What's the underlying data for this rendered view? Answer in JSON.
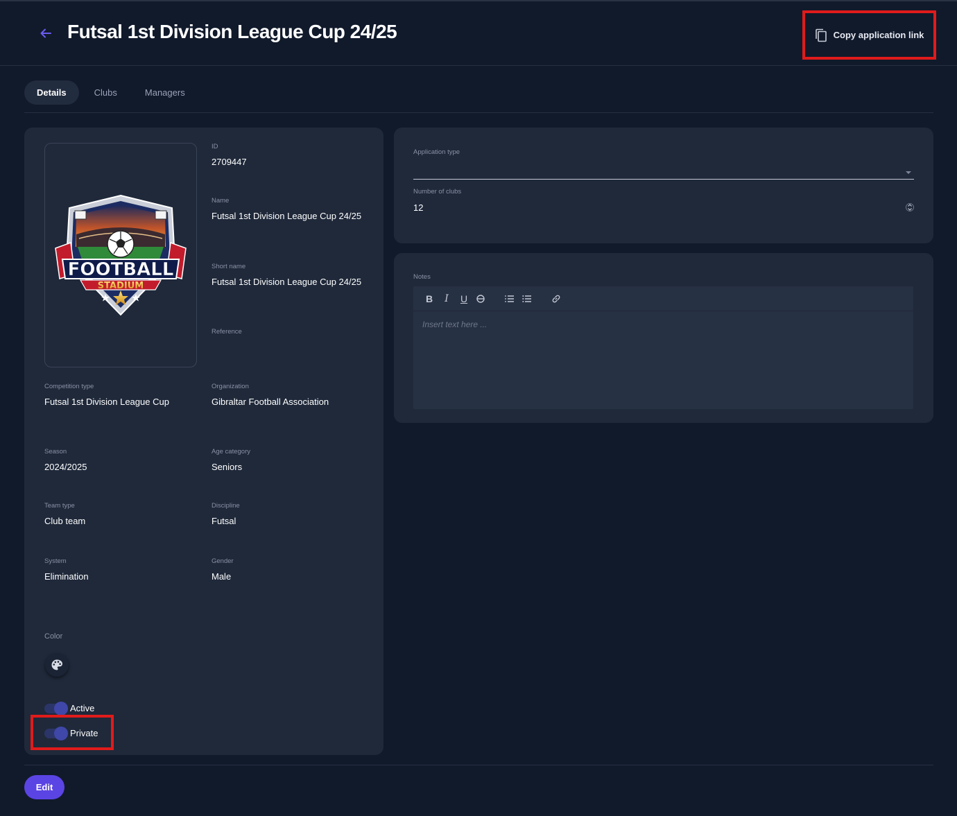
{
  "header": {
    "title": "Futsal 1st Division League Cup 24/25",
    "copy_link_label": "Copy application link"
  },
  "tabs": [
    {
      "label": "Details",
      "active": true
    },
    {
      "label": "Clubs",
      "active": false
    },
    {
      "label": "Managers",
      "active": false
    }
  ],
  "details": {
    "logo": {
      "text_top": "FOOTBALL",
      "text_bottom": "STADIUM"
    },
    "id": {
      "label": "ID",
      "value": "2709447"
    },
    "name": {
      "label": "Name",
      "value": "Futsal 1st Division League Cup 24/25"
    },
    "short_name": {
      "label": "Short name",
      "value": "Futsal 1st Division League Cup 24/25"
    },
    "reference": {
      "label": "Reference",
      "value": ""
    },
    "competition_type": {
      "label": "Competition type",
      "value": "Futsal 1st Division League Cup"
    },
    "organization": {
      "label": "Organization",
      "value": "Gibraltar Football Association"
    },
    "season": {
      "label": "Season",
      "value": "2024/2025"
    },
    "age_category": {
      "label": "Age category",
      "value": "Seniors"
    },
    "team_type": {
      "label": "Team type",
      "value": "Club team"
    },
    "discipline": {
      "label": "Discipline",
      "value": "Futsal"
    },
    "system": {
      "label": "System",
      "value": "Elimination"
    },
    "gender": {
      "label": "Gender",
      "value": "Male"
    },
    "color_label": "Color",
    "active": {
      "label": "Active",
      "on": true
    },
    "private": {
      "label": "Private",
      "on": true
    }
  },
  "application": {
    "type_label": "Application type",
    "type_value": "",
    "clubs_label": "Number of clubs",
    "clubs_value": "12"
  },
  "notes": {
    "label": "Notes",
    "placeholder": "Insert text here ...",
    "toolbar": [
      "bold",
      "italic",
      "underline",
      "strikethrough",
      "ordered-list",
      "bullet-list",
      "link"
    ]
  },
  "footer": {
    "edit_label": "Edit"
  },
  "colors": {
    "background": "#111a2b",
    "card": "#1f293a",
    "accent": "#5b44e4",
    "highlight": "#e01b1b"
  }
}
